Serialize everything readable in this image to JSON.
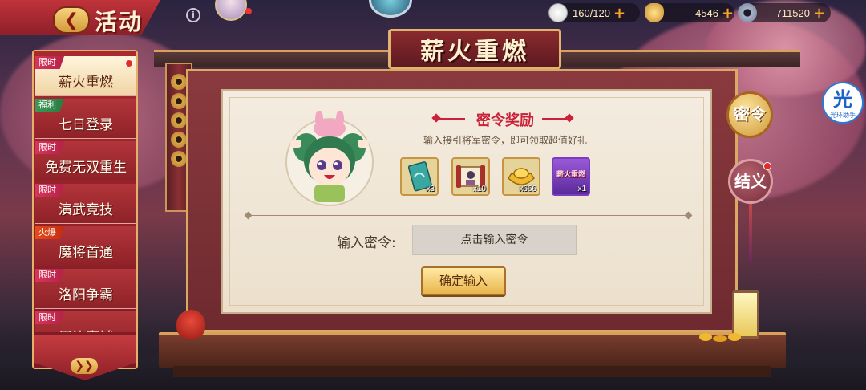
{
  "header": {
    "back_icon": "back-arrow-icon",
    "title": "活动",
    "info_icon": "info-icon"
  },
  "resources": [
    {
      "name": "stamina",
      "icon": "bun-icon",
      "value": "160/120"
    },
    {
      "name": "gold",
      "icon": "gold-ingot-icon",
      "value": "4546"
    },
    {
      "name": "coins",
      "icon": "coin-icon",
      "value": "711520"
    }
  ],
  "plus_symbol": "+",
  "menu": {
    "items": [
      {
        "tag": "限时",
        "label": "薪火重燃",
        "active": true,
        "dot": true
      },
      {
        "tag": "福利",
        "label": "七日登录",
        "active": false,
        "dot": false
      },
      {
        "tag": "限时",
        "label": "免费无双重生",
        "active": false,
        "dot": false
      },
      {
        "tag": "限时",
        "label": "演武竞技",
        "active": false,
        "dot": false
      },
      {
        "tag": "火爆",
        "label": "魔将首通",
        "active": false,
        "dot": false
      },
      {
        "tag": "限时",
        "label": "洛阳争霸",
        "active": false,
        "dot": false
      },
      {
        "tag": "限时",
        "label": "周边商城",
        "active": false,
        "dot": false
      }
    ]
  },
  "page_title": "薪火重燃",
  "reward": {
    "title": "密令奖励",
    "subtitle": "输入接引将军密令，即可领取超值好礼",
    "items": [
      {
        "name": "card-icon",
        "count": "x3"
      },
      {
        "name": "scroll-icon",
        "count": "x10"
      },
      {
        "name": "gold-ingot-icon",
        "count": "x666"
      },
      {
        "name": "xinhuo-badge-icon",
        "count": "x1",
        "text": "薪火重燃"
      }
    ]
  },
  "input": {
    "label": "输入密令:",
    "placeholder": "点击输入密令"
  },
  "confirm_label": "确定输入",
  "side": {
    "mi": "密令",
    "jie": "结义"
  },
  "helper": {
    "char": "光",
    "label": "光环助手"
  },
  "colors": {
    "accent_red": "#c9223a",
    "gold": "#e9b64c",
    "menu_red": "#8e2228"
  }
}
